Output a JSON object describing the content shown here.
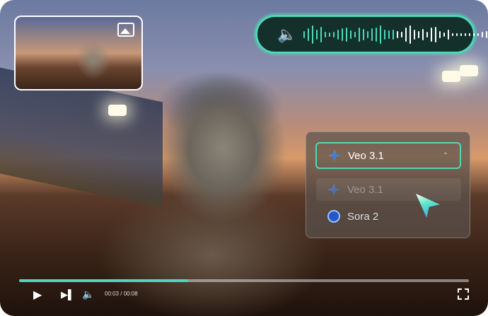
{
  "player": {
    "current_time": "00:03",
    "total_time": "00:08",
    "time_display": "00:03 / 00:08",
    "progress_percent": 37.5
  },
  "audio": {
    "icon": "speaker-icon"
  },
  "thumbnail": {
    "icon": "image-icon"
  },
  "model_dropdown": {
    "selected": "Veo 3.1",
    "options": [
      {
        "label": "Veo 3.1",
        "icon": "veo-star-icon"
      },
      {
        "label": "Sora 2",
        "icon": "sora-icon"
      }
    ]
  },
  "colors": {
    "accent": "#4fd8b8",
    "wave_bg": "#14302a"
  }
}
